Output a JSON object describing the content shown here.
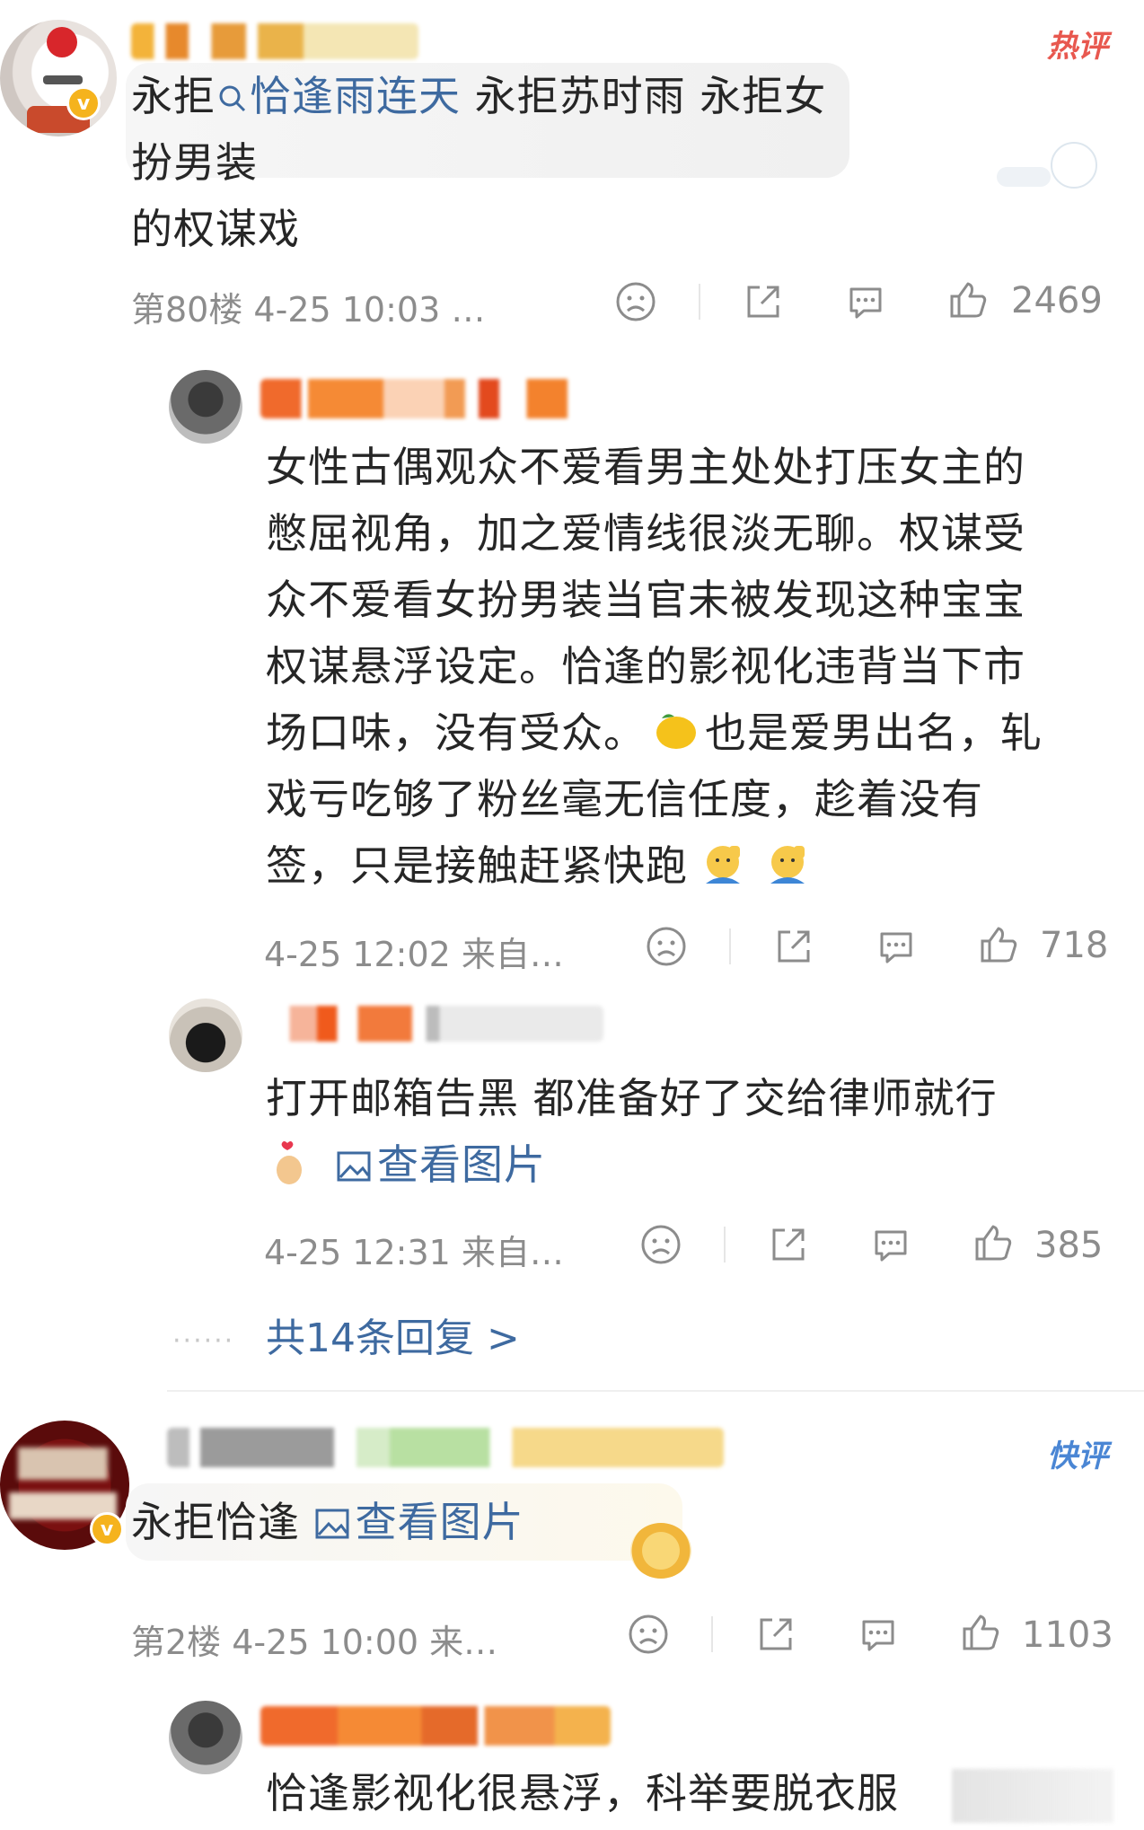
{
  "comments": [
    {
      "badge": "热评",
      "text_prefix": "永拒",
      "link_text": "恰逢雨连天",
      "text_suffix": " 永拒苏时雨 永拒女扮男装",
      "text_line2": "的权谋戏",
      "meta": "第80楼  4-25 10:03 …",
      "likes": "2469"
    },
    {
      "badge": "快评",
      "text_prefix": "永拒恰逢 ",
      "image_link": "查看图片",
      "meta": "第2楼  4-25 10:00  来…",
      "likes": "1103"
    }
  ],
  "replies": [
    {
      "lines": [
        "女性古偶观众不爱看男主处处打压女主的",
        "憋屈视角，加之爱情线很淡无聊。权谋受",
        "众不爱看女扮男装当官未被发现这种宝宝",
        "权谋悬浮设定。恰逢的影视化违背当下市",
        "场口味，没有受众。",
        "也是爱男出名，轧",
        "戏亏吃够了粉丝毫无信任度，趁着没有",
        "签，只是接触赶紧快跑"
      ],
      "meta": "4-25 12:02  来自…",
      "likes": "718"
    },
    {
      "line1": "打开邮箱告黑 都准备好了交给律师就行",
      "image_link": "查看图片",
      "meta": "4-25 12:31  来自…",
      "likes": "385"
    },
    {
      "line1": "恰逢影视化很悬浮，科举要脱衣服"
    }
  ],
  "more_replies": "共14条回复 >",
  "icons": [
    "dislike-icon",
    "share-icon",
    "comment-icon",
    "like-icon",
    "search-icon",
    "image-icon",
    "lemon-emoji",
    "salute-emoji",
    "finger-heart-emoji"
  ],
  "colors": {
    "link": "#3e6aa0",
    "hot_badge": "#e8584f",
    "fast_badge": "#4a86d4",
    "meta": "#8c8c8c",
    "verified": "#f5b31d"
  }
}
